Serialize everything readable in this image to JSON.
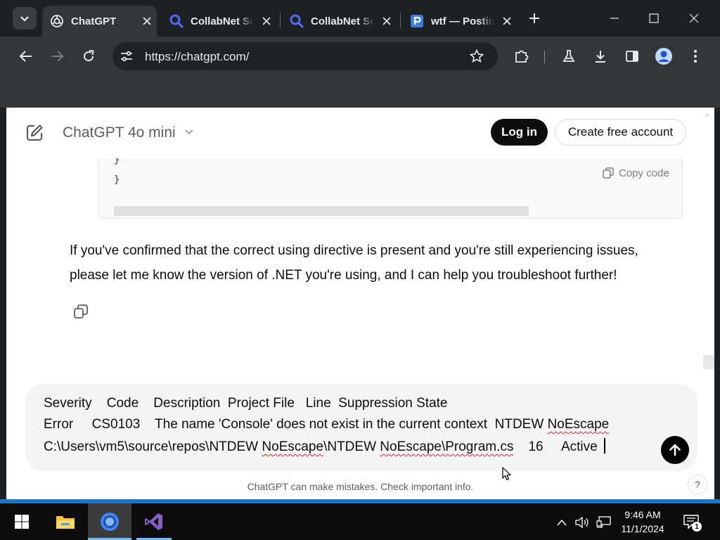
{
  "browser": {
    "tabs": [
      {
        "title": "ChatGPT",
        "icon": "chatgpt-logo-icon",
        "active": true
      },
      {
        "title": "CollabNet Sear",
        "icon": "search-favicon-icon",
        "active": false
      },
      {
        "title": "CollabNet Sear",
        "icon": "search-favicon-icon",
        "active": false
      },
      {
        "title": "wtf — Postim",
        "icon": "postimages-favicon-icon",
        "active": false
      }
    ],
    "url": "https://chatgpt.com/"
  },
  "header": {
    "model_name": "ChatGPT 4o mini",
    "login_label": "Log in",
    "signup_label": "Create free account"
  },
  "code_block": {
    "lines": [
      "    }",
      "}"
    ],
    "copy_label": "Copy code"
  },
  "answer": {
    "text": "If you've confirmed that the correct using directive is present and you're still experiencing issues, please let me know the version of .NET you're using, and I can help you troubleshoot further!"
  },
  "composer": {
    "line1": "Severity    Code    Description  Project File   Line  Suppression State",
    "line2_a": "Error     CS0103    The name 'Console' does not exist in the current context  NTDEW ",
    "line2_b": "NoEscape",
    "line3_a": "C:\\Users\\vm5\\source\\repos\\NTDEW ",
    "line3_b": "NoEscape",
    "line3_c": "\\NTDEW ",
    "line3_d": "NoEscape\\Program.cs",
    "line3_e": "    16     Active "
  },
  "footer": {
    "disclaimer": "ChatGPT can make mistakes. Check important info.",
    "help": "?"
  },
  "taskbar": {
    "time": "9:46 AM",
    "date": "11/1/2024",
    "notification_count": "1"
  },
  "colors": {
    "chrome_bg": "#1f2024",
    "toolbar_bg": "#35363a",
    "accent_black": "#0d0d0d",
    "taskbar_bg": "#0c0c0c"
  }
}
